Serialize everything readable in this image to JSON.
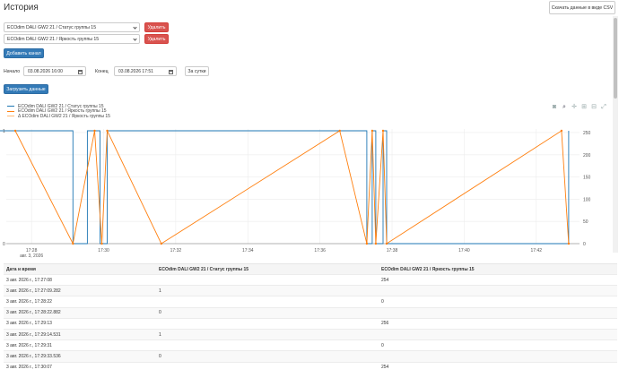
{
  "header": {
    "title": "История",
    "csv_button": "Скачать данные в виде CSV"
  },
  "channels": [
    {
      "value": "ECOdim DALI GW2 21 / Статус группы 15",
      "delete_label": "Удалить"
    },
    {
      "value": "ECOdim DALI GW2 21 / Яркость группы 15",
      "delete_label": "Удалить"
    }
  ],
  "add_channel_label": "Добавить канал",
  "range": {
    "start_label": "Начало",
    "start_value": "03.08.2026 16:00",
    "end_label": "Конец",
    "end_value": "03.08.2026 17:51",
    "day_button": "За сутки"
  },
  "load_button": "Загрузить данные",
  "legend": [
    {
      "name": "ECOdim DALI GW2 21 / Статус группы 15",
      "color": "#1f77b4"
    },
    {
      "name": "ECOdim DALI GW2 21 / Яркость группы 15",
      "color": "#ff7f0e"
    },
    {
      "name": "Δ ECOdim DALI GW2 21 / Яркость группы 15",
      "color": "#ffbb78"
    }
  ],
  "modebar_icons": [
    "camera-icon",
    "zoom-icon",
    "pan-icon",
    "zoom-in-icon",
    "zoom-out-icon",
    "autoscale-icon"
  ],
  "chart_data": {
    "type": "line",
    "x_ticks": [
      "17:28",
      "17:30",
      "17:32",
      "17:34",
      "17:36",
      "17:38",
      "17:40",
      "17:42"
    ],
    "x_date_label": "авг. 3, 2026",
    "y_left_ticks": [
      "0",
      "1"
    ],
    "y_right_ticks": [
      "0",
      "50",
      "100",
      "150",
      "200",
      "250"
    ],
    "xlim": [
      27.3,
      43.2
    ],
    "series": [
      {
        "name": "ECOdim DALI GW2 21 / Статус группы 15",
        "axis": "left",
        "color": "#1f77b4",
        "x": [
          27.1,
          29.15,
          29.15,
          29.55,
          29.55,
          29.9,
          29.9,
          30.1,
          30.1,
          37.3,
          37.3,
          37.45,
          37.45,
          37.55,
          37.55,
          37.75,
          37.75,
          37.85,
          37.85,
          42.9,
          42.9
        ],
        "y": [
          1,
          1,
          0,
          0,
          1,
          1,
          0,
          0,
          1,
          1,
          0,
          0,
          1,
          1,
          0,
          0,
          1,
          1,
          0,
          0,
          1
        ]
      },
      {
        "name": "ECOdim DALI GW2 21 / Яркость группы 15",
        "axis": "right",
        "color": "#ff7f0e",
        "x": [
          27.55,
          29.15,
          29.75,
          29.95,
          30.1,
          31.6,
          36.55,
          37.3,
          37.45,
          37.55,
          37.75,
          37.85,
          42.7,
          42.9
        ],
        "y": [
          254,
          0,
          254,
          0,
          254,
          0,
          254,
          0,
          254,
          0,
          254,
          0,
          254,
          0
        ]
      }
    ]
  },
  "table": {
    "headers": [
      "Дата и время",
      "ECOdim DALI GW2 21 / Статус группы 15",
      "ECOdim DALI GW2 21 / Яркость группы 15"
    ],
    "rows": [
      [
        "3 авг. 2026 г., 17:27:08",
        "",
        "254"
      ],
      [
        "3 авг. 2026 г., 17:27:09.282",
        "1",
        ""
      ],
      [
        "3 авг. 2026 г., 17:28:22",
        "",
        "0"
      ],
      [
        "3 авг. 2026 г., 17:28:22.882",
        "0",
        ""
      ],
      [
        "3 авг. 2026 г., 17:29:13",
        "",
        "256"
      ],
      [
        "3 авг. 2026 г., 17:29:14.531",
        "1",
        ""
      ],
      [
        "3 авг. 2026 г., 17:29:31",
        "",
        "0"
      ],
      [
        "3 авг. 2026 г., 17:29:33.536",
        "0",
        ""
      ],
      [
        "3 авг. 2026 г., 17:30:07",
        "",
        "254"
      ]
    ]
  }
}
